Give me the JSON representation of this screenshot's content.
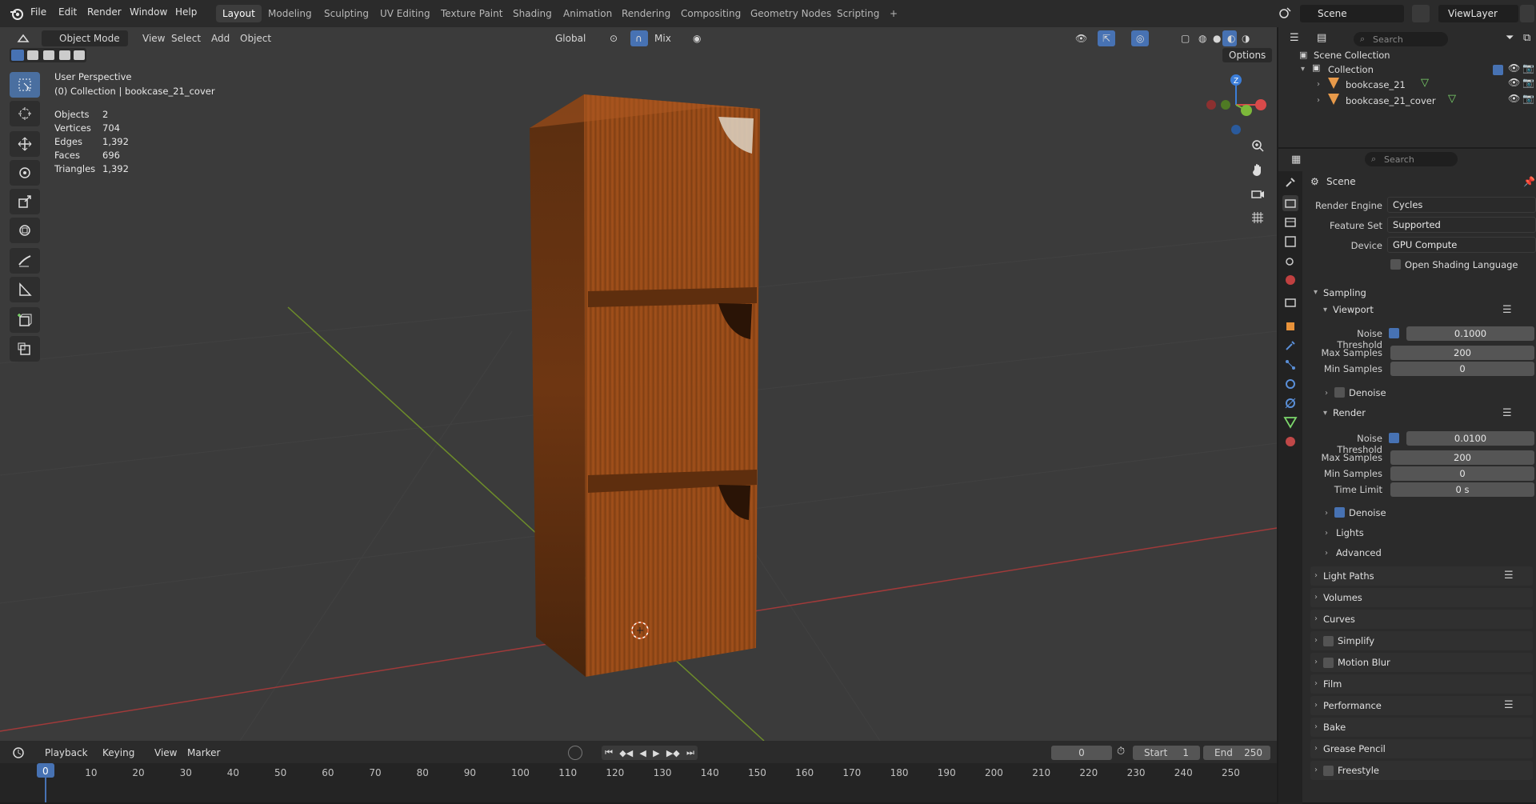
{
  "app": {
    "menus": [
      "File",
      "Edit",
      "Render",
      "Window",
      "Help"
    ],
    "workspaces": [
      "Layout",
      "Modeling",
      "Sculpting",
      "UV Editing",
      "Texture Paint",
      "Shading",
      "Animation",
      "Rendering",
      "Compositing",
      "Geometry Nodes",
      "Scripting"
    ],
    "add_workspace": "+",
    "scene_name": "Scene",
    "view_layer": "ViewLayer"
  },
  "viewport": {
    "mode": "Object Mode",
    "menu": [
      "View",
      "Select",
      "Add",
      "Object"
    ],
    "orientation": "Global",
    "snap_mode": "Mix",
    "options": "Options",
    "perspective": "User Perspective",
    "collection_info": "(0) Collection | bookcase_21_cover",
    "stats": [
      {
        "label": "Objects",
        "value": "2"
      },
      {
        "label": "Vertices",
        "value": "704"
      },
      {
        "label": "Edges",
        "value": "1,392"
      },
      {
        "label": "Faces",
        "value": "696"
      },
      {
        "label": "Triangles",
        "value": "1,392"
      }
    ],
    "gizmo_axis": "Z"
  },
  "timeline": {
    "menu": [
      "Playback",
      "Keying",
      "View",
      "Marker"
    ],
    "current_frame": "0",
    "start_label": "Start",
    "start_value": "1",
    "end_label": "End",
    "end_value": "250",
    "ticks": [
      "0",
      "10",
      "20",
      "30",
      "40",
      "50",
      "60",
      "70",
      "80",
      "90",
      "100",
      "110",
      "120",
      "130",
      "140",
      "150",
      "160",
      "170",
      "180",
      "190",
      "200",
      "210",
      "220",
      "230",
      "240",
      "250"
    ]
  },
  "outliner": {
    "search_placeholder": "Search",
    "root": "Scene Collection",
    "collection": "Collection",
    "objects": [
      "bookcase_21",
      "bookcase_21_cover"
    ]
  },
  "properties": {
    "search_placeholder": "Search",
    "context": "Scene",
    "render_engine_label": "Render Engine",
    "render_engine": "Cycles",
    "feature_set_label": "Feature Set",
    "feature_set": "Supported",
    "device_label": "Device",
    "device": "GPU Compute",
    "osl_label": "Open Shading Language",
    "sampling": "Sampling",
    "viewport_sub": "Viewport",
    "noise_threshold_label": "Noise Threshold",
    "viewport_noise": "0.1000",
    "max_samples_label": "Max Samples",
    "viewport_max": "200",
    "min_samples_label": "Min Samples",
    "viewport_min": "0",
    "denoise_label": "Denoise",
    "render_sub": "Render",
    "render_noise": "0.0100",
    "render_max": "200",
    "render_min": "0",
    "time_limit_label": "Time Limit",
    "time_limit": "0 s",
    "lights": "Lights",
    "advanced": "Advanced",
    "sections": [
      "Light Paths",
      "Volumes",
      "Curves",
      "Simplify",
      "Motion Blur",
      "Film",
      "Performance",
      "Bake",
      "Grease Pencil",
      "Freestyle"
    ]
  }
}
